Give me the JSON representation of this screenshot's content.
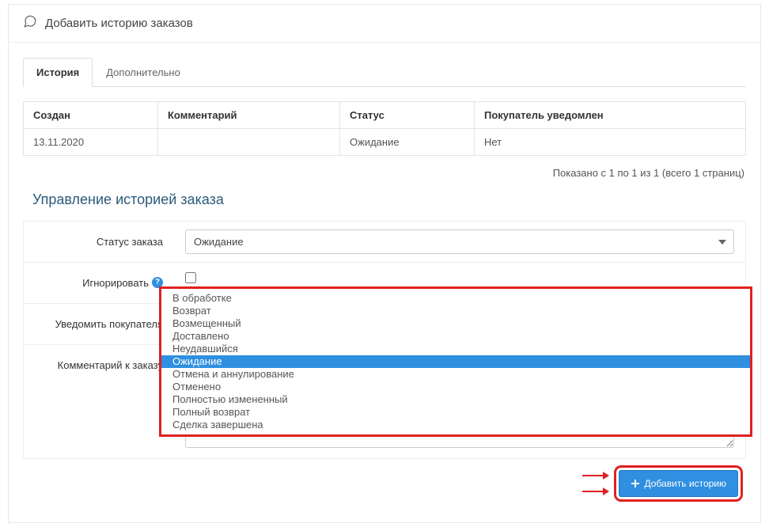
{
  "header": {
    "title": "Добавить историю заказов"
  },
  "tabs": [
    {
      "label": "История",
      "active": true
    },
    {
      "label": "Дополнительно",
      "active": false
    }
  ],
  "history_table": {
    "columns": [
      "Создан",
      "Комментарий",
      "Статус",
      "Покупатель уведомлен"
    ],
    "rows": [
      {
        "created": "13.11.2020",
        "comment": "",
        "status": "Ожидание",
        "notified": "Нет"
      }
    ]
  },
  "pagination": "Показано с 1 по 1 из 1 (всего 1 страниц)",
  "section_title": "Управление историей заказа",
  "form": {
    "status_label": "Статус заказа",
    "status_value": "Ожидание",
    "status_options": [
      "В обработке",
      "Возврат",
      "Возмещенный",
      "Доставлено",
      "Неудавшийся",
      "Ожидание",
      "Отмена и аннулирование",
      "Отменено",
      "Полностью измененный",
      "Полный возврат",
      "Сделка завершена"
    ],
    "status_selected_index": 5,
    "ignore_label": "Игнорировать",
    "notify_label": "Уведомить покупателя",
    "comment_label": "Комментарий к заказу",
    "submit_label": "Добавить историю"
  }
}
